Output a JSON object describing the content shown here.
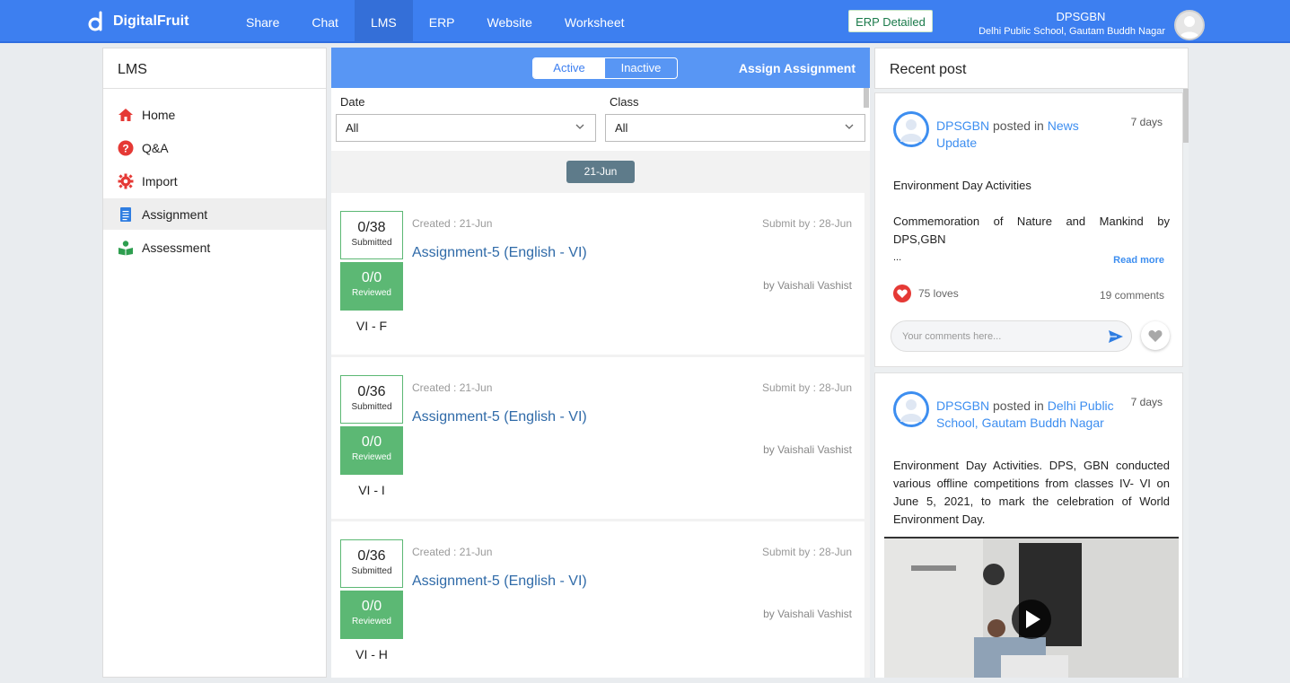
{
  "header": {
    "brand": "DigitalFruit",
    "nav": [
      "Share",
      "Chat",
      "LMS",
      "ERP",
      "Website",
      "Worksheet"
    ],
    "active_nav": "LMS",
    "erp_button": "ERP Detailed",
    "school_code": "DPSGBN",
    "school_name": "Delhi Public School, Gautam Buddh Nagar"
  },
  "sidebar": {
    "title": "LMS",
    "items": [
      {
        "label": "Home",
        "icon": "home-icon",
        "color": "#e53935"
      },
      {
        "label": "Q&A",
        "icon": "question-icon",
        "color": "#e53935"
      },
      {
        "label": "Import",
        "icon": "gear-icon",
        "color": "#e53935"
      },
      {
        "label": "Assignment",
        "icon": "document-icon",
        "color": "#2f7de1"
      },
      {
        "label": "Assessment",
        "icon": "reader-icon",
        "color": "#2e9e4f"
      }
    ],
    "active": "Assignment"
  },
  "assignments_panel": {
    "toggle_active": "Active",
    "toggle_inactive": "Inactive",
    "assign_link": "Assign Assignment",
    "date_label": "Date",
    "date_value": "All",
    "class_label": "Class",
    "class_value": "All",
    "date_group": "21-Jun",
    "cards": [
      {
        "submitted": "0/38",
        "submitted_label": "Submitted",
        "reviewed": "0/0",
        "reviewed_label": "Reviewed",
        "class": "VI - F",
        "created": "Created : 21-Jun",
        "submit_by": "Submit by : 28-Jun",
        "title": "Assignment-5 (English - VI)",
        "by": "by Vaishali Vashist"
      },
      {
        "submitted": "0/36",
        "submitted_label": "Submitted",
        "reviewed": "0/0",
        "reviewed_label": "Reviewed",
        "class": "VI - I",
        "created": "Created : 21-Jun",
        "submit_by": "Submit by : 28-Jun",
        "title": "Assignment-5 (English - VI)",
        "by": "by Vaishali Vashist"
      },
      {
        "submitted": "0/36",
        "submitted_label": "Submitted",
        "reviewed": "0/0",
        "reviewed_label": "Reviewed",
        "class": "VI - H",
        "created": "Created : 21-Jun",
        "submit_by": "Submit by : 28-Jun",
        "title": "Assignment-5 (English - VI)",
        "by": "by Vaishali Vashist"
      }
    ]
  },
  "recent": {
    "title": "Recent post",
    "posts": [
      {
        "author": "DPSGBN",
        "posted_in_text": "posted in",
        "category": "News Update",
        "age": "7 days",
        "body_title": "Environment Day Activities",
        "body": "Commemoration of Nature and Mankind by DPS,GBN",
        "ellipsis": "...",
        "read_more": "Read more",
        "loves": "75 loves",
        "comments": "19 comments",
        "comment_placeholder": "Your comments here..."
      },
      {
        "author": "DPSGBN",
        "posted_in_text": "posted in",
        "category": "Delhi Public School, Gautam Buddh Nagar",
        "age": "7 days",
        "body": "Environment Day Activities. DPS, GBN conducted various offline competitions from classes IV- VI on June 5, 2021, to mark the celebration of World Environment Day."
      }
    ]
  },
  "colors": {
    "accent": "#3d7ff0",
    "green": "#5cb874",
    "link": "#2f6aa8"
  }
}
